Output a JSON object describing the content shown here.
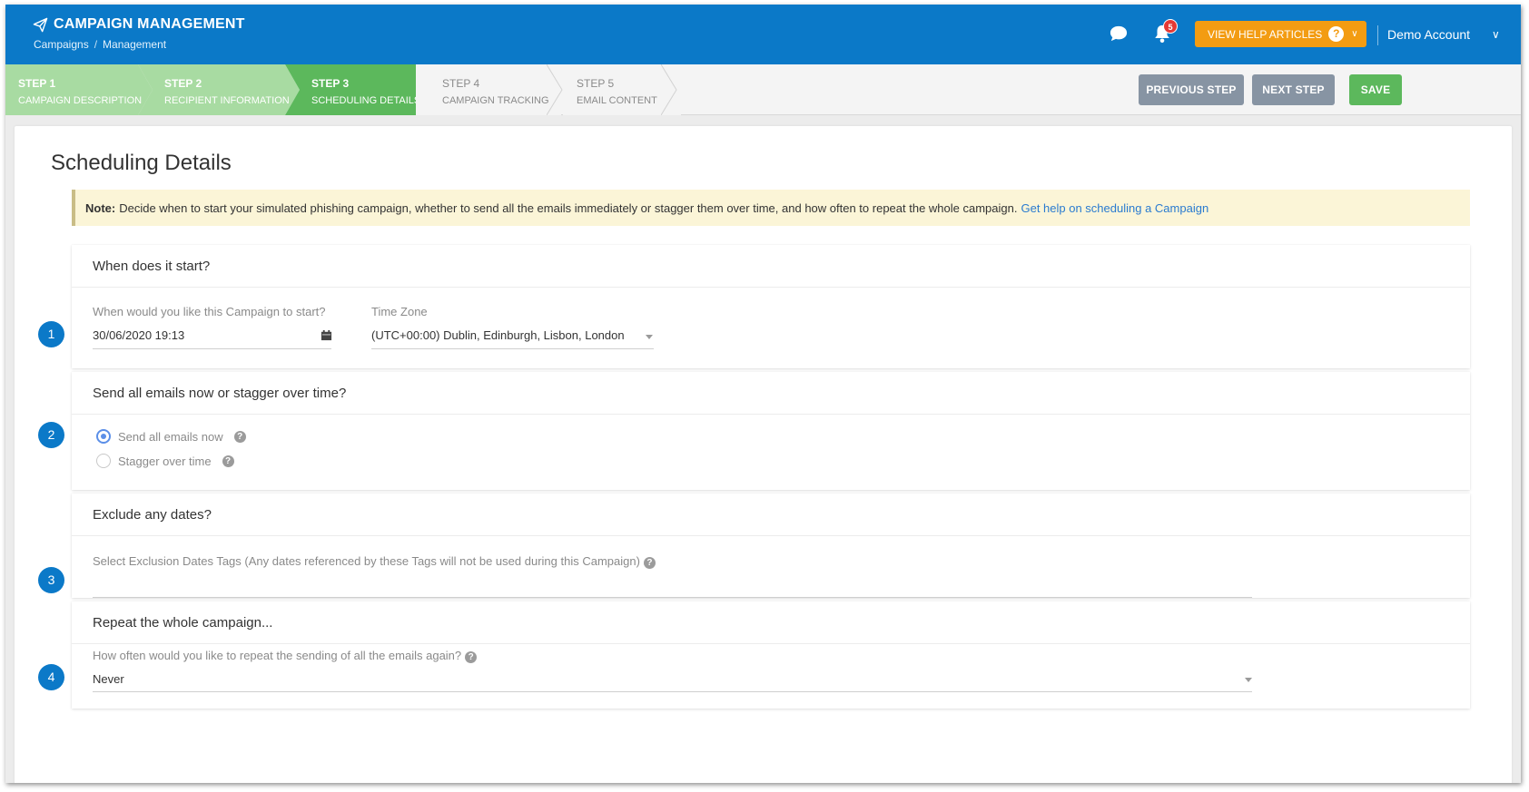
{
  "header": {
    "title": "CAMPAIGN MANAGEMENT",
    "breadcrumb": [
      "Campaigns",
      "/",
      "Management"
    ],
    "notifications_count": "5",
    "help_button": "VIEW HELP ARTICLES",
    "help_symbol": "?",
    "account": "Demo Account",
    "icons": [
      "paper-plane-icon",
      "chat-icon",
      "bell-icon",
      "chevron-down-icon"
    ]
  },
  "steps": [
    {
      "num": "STEP 1",
      "name": "CAMPAIGN DESCRIPTION",
      "state": "done"
    },
    {
      "num": "STEP 2",
      "name": "RECIPIENT INFORMATION",
      "state": "done"
    },
    {
      "num": "STEP 3",
      "name": "SCHEDULING DETAILS",
      "state": "active"
    },
    {
      "num": "STEP 4",
      "name": "CAMPAIGN TRACKING",
      "state": "todo"
    },
    {
      "num": "STEP 5",
      "name": "EMAIL CONTENT",
      "state": "todo"
    }
  ],
  "step_buttons": {
    "previous": "PREVIOUS STEP",
    "next": "NEXT STEP",
    "save": "SAVE"
  },
  "page": {
    "title": "Scheduling Details",
    "note_label": "Note:",
    "note_text": "Decide when to start your simulated phishing campaign, whether to send all the emails immediately or stagger them over time, and how often to repeat the whole campaign.",
    "note_link": "Get help on scheduling a Campaign"
  },
  "sections": {
    "start": {
      "number": "1",
      "title": "When does it start?",
      "start_label": "When would you like this Campaign to start?",
      "start_value": "30/06/2020 19:13",
      "timezone_label": "Time Zone",
      "timezone_value": "(UTC+00:00) Dublin, Edinburgh, Lisbon, London"
    },
    "send": {
      "number": "2",
      "title": "Send all emails now or stagger over time?",
      "option_now": "Send all emails now",
      "option_stagger": "Stagger over time",
      "selected": "Send all emails now"
    },
    "exclude": {
      "number": "3",
      "title": "Exclude any dates?",
      "label": "Select Exclusion Dates Tags (Any dates referenced by these Tags will not be used during this Campaign)"
    },
    "repeat": {
      "number": "4",
      "title": "Repeat the whole campaign...",
      "label": "How often would you like to repeat the sending of all the emails again?",
      "value": "Never"
    }
  },
  "colors": {
    "header_blue": "#0b79c8",
    "step_done": "#a8dba2",
    "step_active": "#5cb85c",
    "button_grey": "#8794a3",
    "button_orange": "#f39c12",
    "note_bg": "#fbf5d7",
    "link_blue": "#2a7bd0"
  }
}
